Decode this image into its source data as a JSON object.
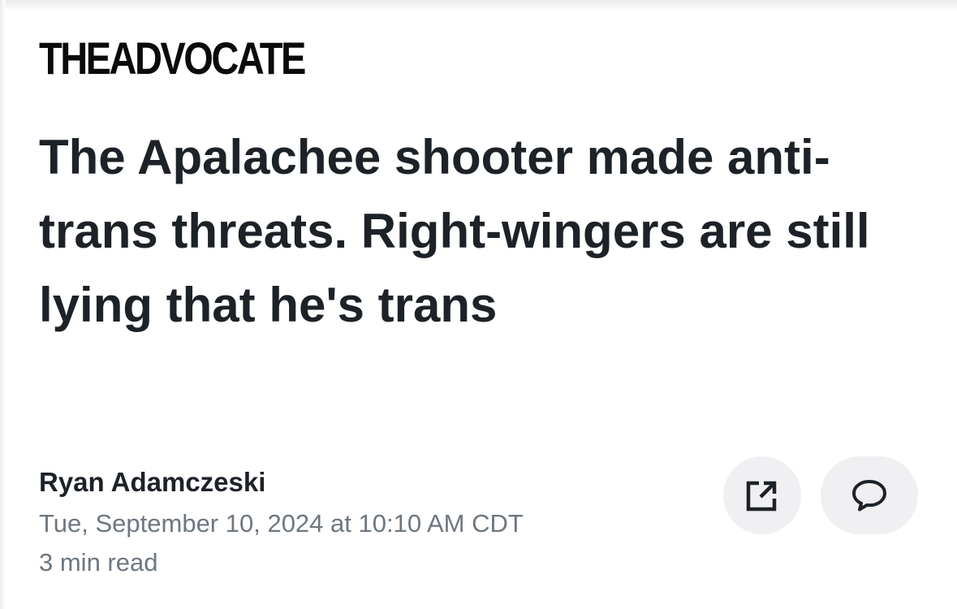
{
  "publication": {
    "logo_text": "THEADVOCATE"
  },
  "article": {
    "headline": "The Apalachee shooter made anti-trans threats. Right-wingers are still lying that he's trans",
    "author": "Ryan Adamczeski",
    "timestamp": "Tue, September 10, 2024 at 10:10 AM CDT",
    "read_time": "3 min read"
  },
  "actions": {
    "share_icon": "external-share-icon",
    "comment_icon": "speech-bubble-icon"
  },
  "colors": {
    "text_primary": "#1d2228",
    "text_secondary": "#6e7780",
    "button_bg": "#f0f0f3"
  }
}
